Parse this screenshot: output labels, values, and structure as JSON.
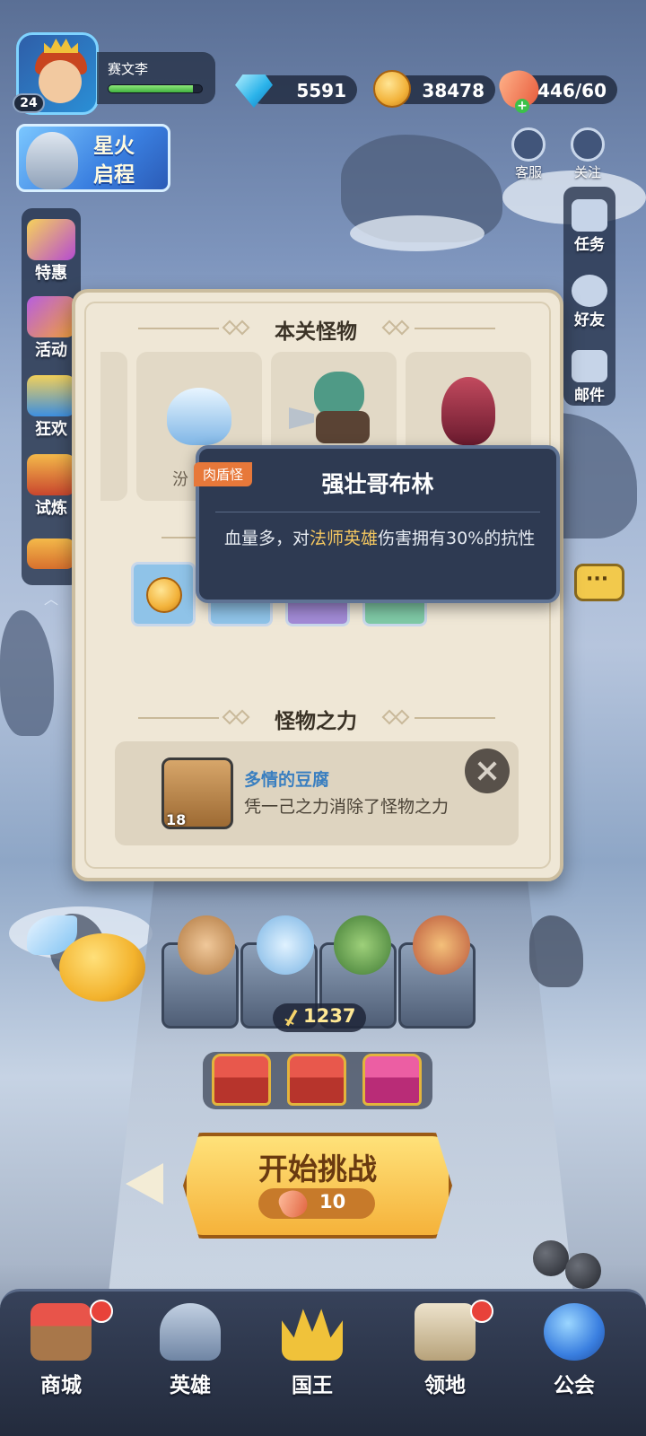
{
  "player": {
    "name": "赛文李",
    "level": "24",
    "exp_fraction": 0.9
  },
  "resources": {
    "gems": "5591",
    "gold": "38478",
    "stamina": "446/60"
  },
  "event_banner": {
    "line1": "星火",
    "line2": "启程"
  },
  "top_right": [
    {
      "label": "客服",
      "icon": "customer-service-icon"
    },
    {
      "label": "关注",
      "icon": "star-follow-icon"
    }
  ],
  "side_left": [
    {
      "label": "特惠",
      "icon": "gift-card-icon"
    },
    {
      "label": "活动",
      "icon": "activity-horn-icon"
    },
    {
      "label": "狂欢",
      "icon": "carnival-chest-icon"
    },
    {
      "label": "试炼",
      "icon": "trial-chest-icon"
    }
  ],
  "side_right": [
    {
      "label": "任务",
      "icon": "calendar-task-icon"
    },
    {
      "label": "好友",
      "icon": "friends-icon"
    },
    {
      "label": "邮件",
      "icon": "mail-icon"
    }
  ],
  "dialog": {
    "monsters_title": "本关怪物",
    "monster_name_partial": "汾",
    "power_title": "怪物之力",
    "power_hero_name": "多情的豆腐",
    "power_hero_level": "18",
    "power_desc": "凭一己之力消除了怪物之力"
  },
  "tooltip": {
    "tag": "肉盾怪",
    "title": "强壮哥布林",
    "desc_pre": "血量多，对",
    "desc_highlight": "法师英雄",
    "desc_post": "伤害拥有30%的抗性"
  },
  "lineup": {
    "combat_power": "1237"
  },
  "start_button": {
    "label": "开始挑战",
    "cost": "10"
  },
  "nav": [
    {
      "label": "商城",
      "icon": "shop-icon",
      "badge": true
    },
    {
      "label": "英雄",
      "icon": "hero-helmet-icon",
      "badge": false
    },
    {
      "label": "国王",
      "icon": "crown-icon",
      "badge": false
    },
    {
      "label": "领地",
      "icon": "castle-icon",
      "badge": true
    },
    {
      "label": "公会",
      "icon": "guild-planet-icon",
      "badge": false
    }
  ],
  "colors": {
    "accent_orange": "#f5b23a",
    "tooltip_bg": "#2e3a52",
    "highlight": "#f4c760",
    "hero_name_blue": "#3a7fc0"
  }
}
